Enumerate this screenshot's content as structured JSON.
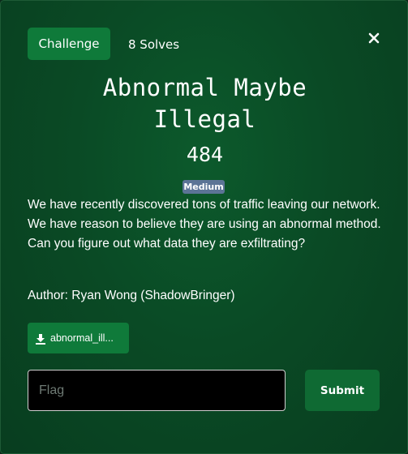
{
  "tabs": {
    "challenge_label": "Challenge",
    "solves_label": "8 Solves"
  },
  "close_icon": "close-icon",
  "challenge": {
    "title": "Abnormal Maybe Illegal",
    "value": "484",
    "difficulty": "Medium",
    "description": "We have recently discovered tons of traffic leaving our network. We have reason to believe they are using an abnormal method. Can you figure out what data they are exfiltrating?",
    "author": "Author: Ryan Wong (ShadowBringer)"
  },
  "files": [
    {
      "label": "abnormal_ill...",
      "icon": "download-icon"
    }
  ],
  "flag_form": {
    "placeholder": "Flag",
    "value": "",
    "submit_label": "Submit"
  },
  "colors": {
    "background": "#0a4a25",
    "accent_button": "#0f7a3a",
    "badge": "#5c7496",
    "input_bg": "#000000"
  }
}
